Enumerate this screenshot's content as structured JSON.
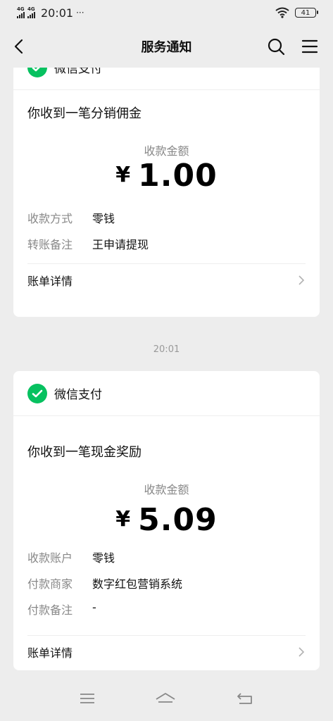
{
  "status_bar": {
    "signal_1": "4G",
    "signal_2": "4G",
    "time": "20:01",
    "more": "···",
    "battery": "41"
  },
  "nav": {
    "title": "服务通知"
  },
  "card1": {
    "source": "微信支付",
    "title": "你收到一笔分销佣金",
    "amount_label": "收款金额",
    "currency": "¥",
    "amount": "1.00",
    "rows": [
      {
        "key": "收款方式",
        "value": "零钱"
      },
      {
        "key": "转账备注",
        "value": "王申请提现"
      }
    ],
    "detail": "账单详情"
  },
  "timestamp": "20:01",
  "card2": {
    "source": "微信支付",
    "title": "你收到一笔现金奖励",
    "amount_label": "收款金额",
    "currency": "¥",
    "amount": "5.09",
    "rows": [
      {
        "key": "收款账户",
        "value": "零钱"
      },
      {
        "key": "付款商家",
        "value": "数字红包营销系统"
      },
      {
        "key": "付款备注",
        "value": "-"
      }
    ],
    "detail": "账单详情"
  },
  "icons": {
    "back": "chevron-left-icon",
    "search": "search-icon",
    "menu": "menu-icon",
    "wechat_pay": "wechat-pay-icon",
    "chevron": "chevron-right-icon"
  },
  "colors": {
    "wechat_green": "#07c160",
    "background": "#ededed"
  }
}
